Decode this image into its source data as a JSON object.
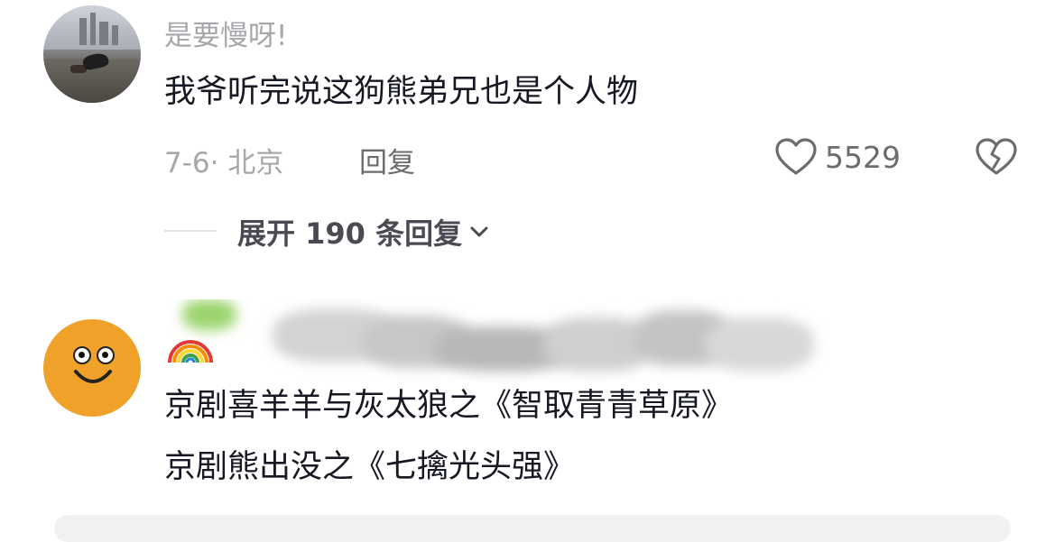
{
  "comments": [
    {
      "username": "是要慢呀!",
      "text": "我爷听完说这狗熊弟兄也是个人物",
      "meta": "7-6· 北京",
      "reply_label": "回复",
      "like_count": "5529",
      "expand_label": "展开 190 条回复"
    },
    {
      "username": "",
      "text_lines": [
        "京剧喜羊羊与灰太狼之《智取青青草原》",
        "京剧熊出没之《七擒光头强》"
      ]
    }
  ],
  "icons": {
    "like": "heart-outline-icon",
    "dislike": "broken-heart-icon",
    "expand": "chevron-down-icon",
    "rainbow": "rainbow-emoji"
  },
  "colors": {
    "avatar2_bg": "#f0a12a",
    "text": "#161823",
    "muted": "#a7a7ab"
  }
}
